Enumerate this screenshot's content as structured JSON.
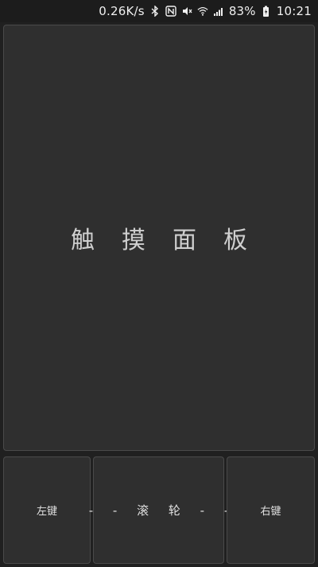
{
  "status_bar": {
    "network_speed": "0.26K/s",
    "battery_percent": "83%",
    "time": "10:21",
    "icons": [
      "bluetooth-icon",
      "nfc-icon",
      "mute-icon",
      "wifi-icon",
      "signal-icon",
      "battery-charging-icon"
    ]
  },
  "touchpad": {
    "label": "触摸面板"
  },
  "buttons": {
    "left_label": "左键",
    "scroll_label": "- - 滚 轮 - -",
    "right_label": "右键"
  },
  "colors": {
    "background": "#202020",
    "panel": "#2f2f2f",
    "panel_border": "#4a4a4a",
    "text": "#d8d8d8"
  }
}
